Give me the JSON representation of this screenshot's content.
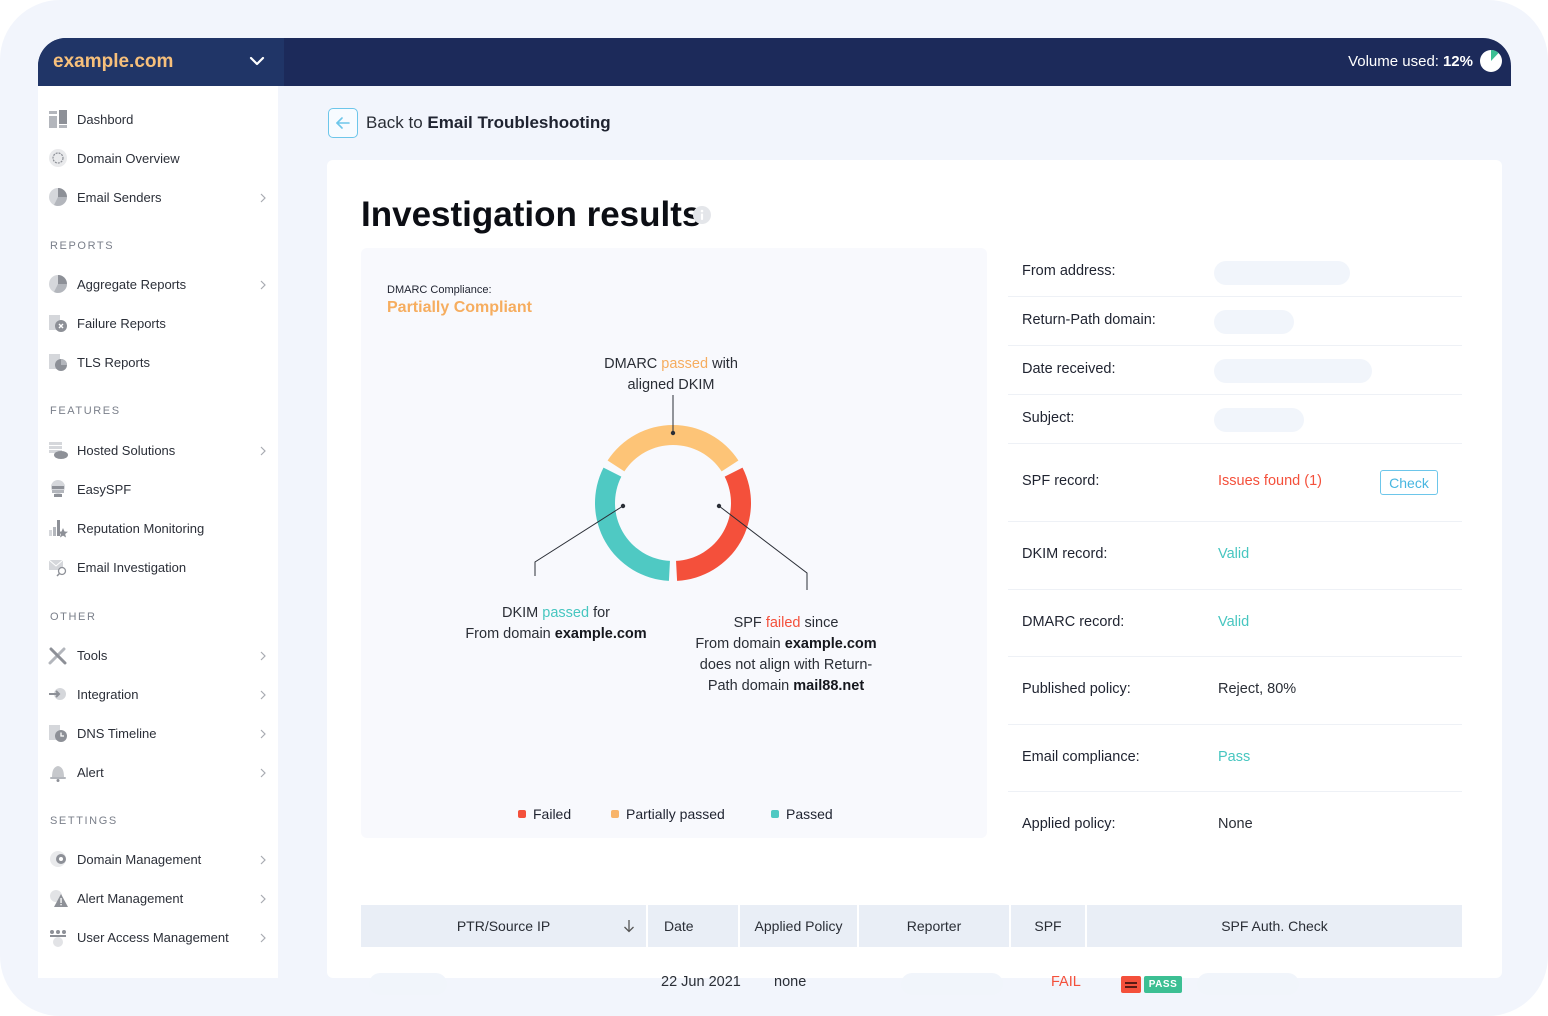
{
  "header": {
    "domain": "example.com",
    "volume_label": "Volume used:",
    "volume_value": "12%",
    "volume_fraction": 0.12
  },
  "sidebar": {
    "items_top": [
      {
        "label": "Dashbord",
        "icon": "dashboard-icon",
        "chevron": false
      },
      {
        "label": "Domain Overview",
        "icon": "globe-icon",
        "chevron": false
      },
      {
        "label": "Email Senders",
        "icon": "pie-chart-icon",
        "chevron": true
      }
    ],
    "sections": [
      {
        "title": "REPORTS",
        "items": [
          {
            "label": "Aggregate Reports",
            "icon": "pie-chart-icon",
            "chevron": true
          },
          {
            "label": "Failure Reports",
            "icon": "report-failure-icon",
            "chevron": false
          },
          {
            "label": "TLS Reports",
            "icon": "report-tls-icon",
            "chevron": false
          }
        ]
      },
      {
        "title": "FEATURES",
        "items": [
          {
            "label": "Hosted Solutions",
            "icon": "cloud-server-icon",
            "chevron": true
          },
          {
            "label": "EasySPF",
            "icon": "easyspf-icon",
            "chevron": false
          },
          {
            "label": "Reputation Monitoring",
            "icon": "reputation-icon",
            "chevron": false
          },
          {
            "label": "Email Investigation",
            "icon": "email-search-icon",
            "chevron": false
          }
        ]
      },
      {
        "title": "OTHER",
        "items": [
          {
            "label": "Tools",
            "icon": "tools-icon",
            "chevron": true
          },
          {
            "label": "Integration",
            "icon": "integration-icon",
            "chevron": true
          },
          {
            "label": "DNS Timeline",
            "icon": "dns-timeline-icon",
            "chevron": true
          },
          {
            "label": "Alert",
            "icon": "bell-icon",
            "chevron": true
          }
        ]
      },
      {
        "title": "SETTINGS",
        "items": [
          {
            "label": "Domain Management",
            "icon": "domain-gear-icon",
            "chevron": true
          },
          {
            "label": "Alert Management",
            "icon": "alert-gear-icon",
            "chevron": true
          },
          {
            "label": "User Access Management",
            "icon": "users-gear-icon",
            "chevron": true
          }
        ]
      }
    ]
  },
  "main": {
    "back_prefix": "Back to ",
    "back_target": "Email Troubleshooting",
    "title": "Investigation results",
    "compliance_label": "DMARC Compliance:",
    "compliance_value": "Partially Compliant",
    "annotations": {
      "dmarc": {
        "pre": "DMARC ",
        "hl": "passed",
        "post": " with",
        "line2": "aligned DKIM"
      },
      "dkim": {
        "pre": "DKIM ",
        "hl": "passed",
        "post": " for",
        "line2_pre": "From domain ",
        "line2_bold": "example.com"
      },
      "spf": {
        "pre": "SPF ",
        "hl": "failed",
        "post": " since",
        "line2_pre": "From domain ",
        "line2_bold": "example.com",
        "line3": "does not align with Return-",
        "line4_pre": "Path domain ",
        "line4_bold": "mail88.net"
      }
    },
    "legend": [
      {
        "label": "Failed",
        "color": "#f4503b"
      },
      {
        "label": "Partially passed",
        "color": "#f8b46a"
      },
      {
        "label": "Passed",
        "color": "#4fc9c3"
      }
    ]
  },
  "chart_data": {
    "type": "pie",
    "title": "DMARC Compliance: Partially Compliant",
    "categories": [
      "DMARC passed with aligned DKIM",
      "SPF failed",
      "DKIM passed"
    ],
    "series": [
      {
        "name": "Partially passed",
        "value": 1,
        "color": "#fdc477"
      },
      {
        "name": "Failed",
        "value": 1,
        "color": "#f4503b"
      },
      {
        "name": "Passed",
        "value": 1,
        "color": "#4fc9c3"
      }
    ],
    "legend": [
      "Failed",
      "Partially passed",
      "Passed"
    ],
    "legend_position": "bottom"
  },
  "details": [
    {
      "label": "From address:",
      "value": null,
      "redacted": true
    },
    {
      "label": "Return-Path domain:",
      "value": null,
      "redacted": true
    },
    {
      "label": "Date received:",
      "value": null,
      "redacted": true
    },
    {
      "label": "Subject:",
      "value": null,
      "redacted": true
    },
    {
      "label": "SPF record:",
      "value": "Issues found (1)",
      "status": "error",
      "action": "Check"
    },
    {
      "label": "DKIM record:",
      "value": "Valid",
      "status": "ok"
    },
    {
      "label": "DMARC record:",
      "value": "Valid",
      "status": "ok"
    },
    {
      "label": "Published policy:",
      "value": "Reject, 80%",
      "status": "neutral"
    },
    {
      "label": "Email compliance:",
      "value": "Pass",
      "status": "ok"
    },
    {
      "label": "Applied policy:",
      "value": "None",
      "status": "neutral"
    }
  ],
  "colors": {
    "ok": "#47c6c0",
    "error": "#f4503b",
    "neutral": "#2a2e36",
    "accent": "#6dc6ea",
    "brand_orange": "#f7c07b",
    "nav_dark": "#1c2a5a"
  },
  "table": {
    "columns": [
      "PTR/Source IP",
      "Date",
      "Applied Policy",
      "Reporter",
      "SPF",
      "SPF Auth. Check"
    ],
    "rows": [
      {
        "ptr": null,
        "date": "22 Jun 2021",
        "applied_policy": "none",
        "reporter": null,
        "spf": "FAIL",
        "spf_auth_badge": "PASS"
      }
    ]
  }
}
